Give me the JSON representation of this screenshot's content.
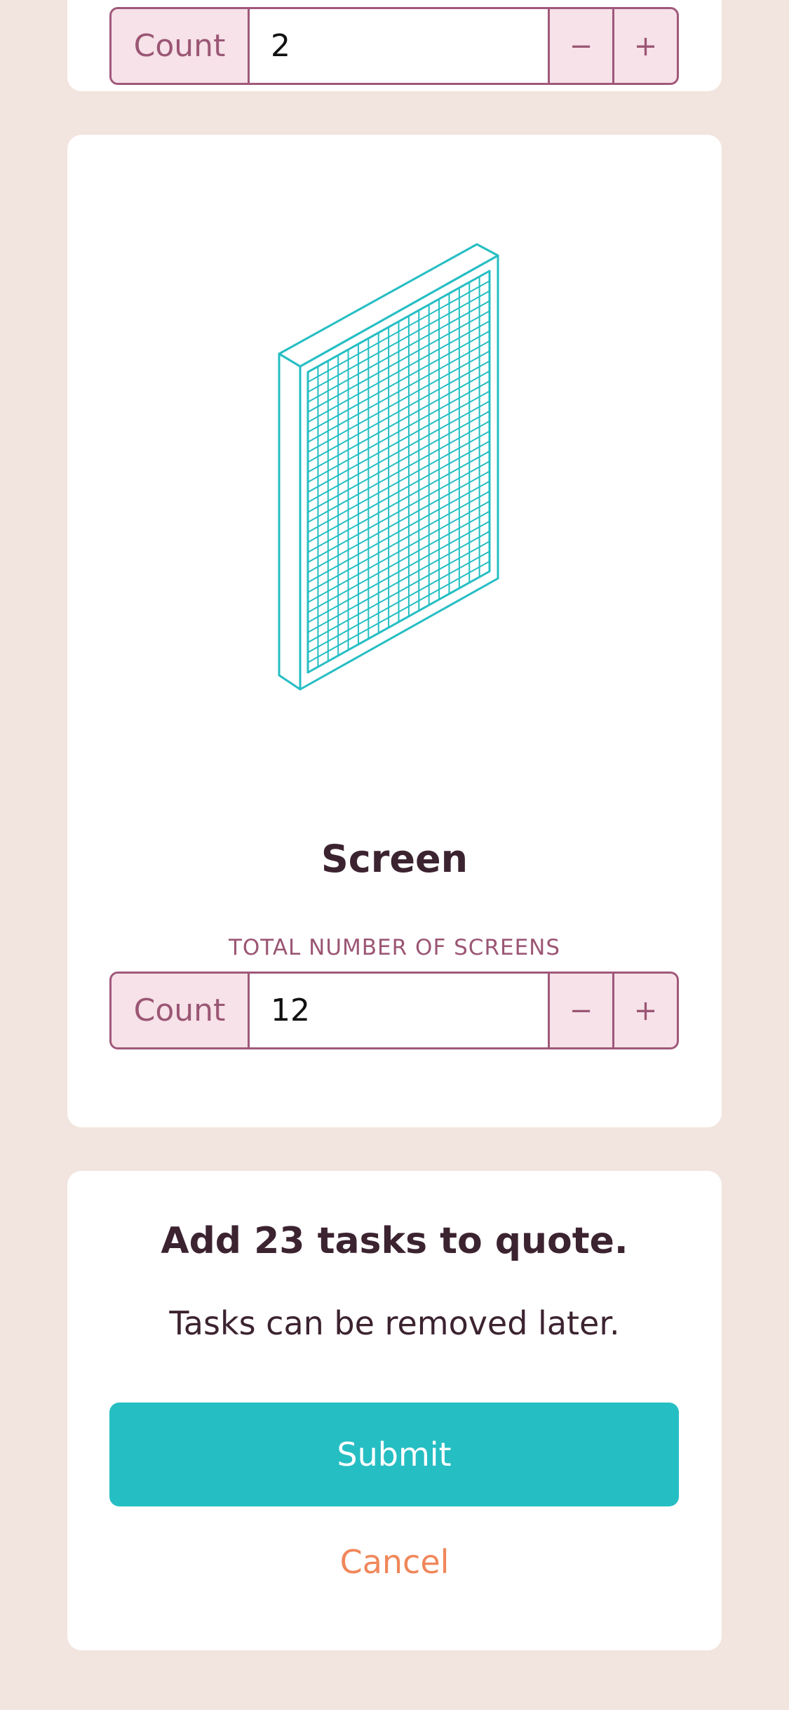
{
  "colors": {
    "background": "#f2e4de",
    "card": "#ffffff",
    "accent_teal": "#25bec3",
    "stepper_border": "#a0587a",
    "stepper_fill": "#f6e2e8",
    "label_text": "#9b5674",
    "heading_text": "#3c2330",
    "cancel_text": "#f0875a"
  },
  "previous_card": {
    "stepper": {
      "addon_label": "Count",
      "value": "2",
      "decrement_label": "−",
      "increment_label": "+"
    }
  },
  "screen_card": {
    "illustration_icon": "screen-panel-icon",
    "title": "Screen",
    "caption": "TOTAL NUMBER OF SCREENS",
    "stepper": {
      "addon_label": "Count",
      "value": "12",
      "decrement_label": "−",
      "increment_label": "+"
    }
  },
  "submit_card": {
    "title": "Add 23 tasks to quote.",
    "subtext": "Tasks can be removed later.",
    "submit_label": "Submit",
    "cancel_label": "Cancel"
  }
}
